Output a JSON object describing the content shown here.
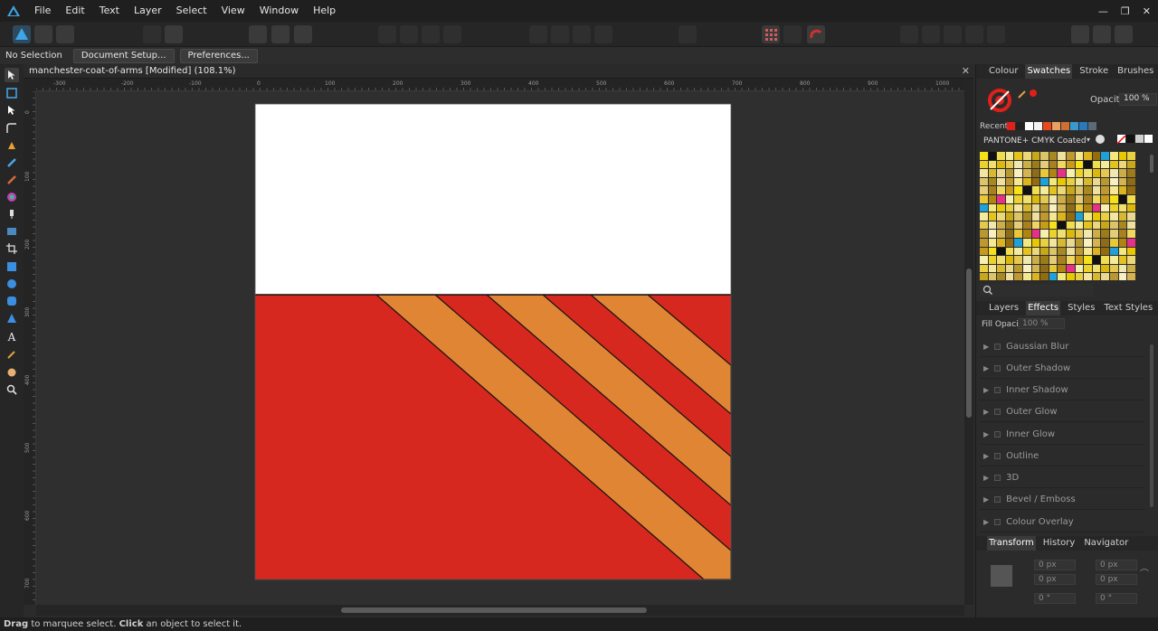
{
  "menu": [
    "File",
    "Edit",
    "Text",
    "Layer",
    "Select",
    "View",
    "Window",
    "Help"
  ],
  "window_controls": [
    "minimize",
    "restore",
    "close"
  ],
  "context": {
    "selection_label": "No Selection",
    "document_setup": "Document Setup...",
    "preferences": "Preferences..."
  },
  "document": {
    "tab_title": "manchester-coat-of-arms [Modified] (108.1%)",
    "close": "✕"
  },
  "ruler": {
    "h_ticks": [
      "-300",
      "-200",
      "-100",
      "0",
      "100",
      "200",
      "300",
      "400",
      "500",
      "600",
      "700",
      "800",
      "900",
      "1000"
    ],
    "v_ticks": [
      "0",
      "100",
      "200",
      "300",
      "400",
      "500",
      "600",
      "700"
    ]
  },
  "colors": {
    "white_band": "#ffffff",
    "red": "#d6281e",
    "orange": "#e08534",
    "outline": "#111111"
  },
  "status": {
    "drag": "Drag",
    "drag_text": " to marquee select. ",
    "click": "Click",
    "click_text": " an object to select it."
  },
  "swatches_panel": {
    "tabs": [
      "Colour",
      "Swatches",
      "Stroke",
      "Brushes"
    ],
    "active_tab": "Swatches",
    "opacity_label": "Opacity:",
    "opacity_value": "100 %",
    "recent_label": "Recent:",
    "palette_name": "PANTONE+ CMYK Coated",
    "recent_colors": [
      "#e0201a",
      "#222222",
      "#ffffff",
      "#f2f2f2",
      "#e8481c",
      "#e9a060",
      "#d07030",
      "#3a9ad0",
      "#2a7ab8",
      "#5a6a78"
    ],
    "grid_colors": [
      "#f7e21a",
      "#e6308a",
      "#1ea0d8",
      "#111111",
      "#f6f0b0",
      "#f3e880",
      "#f0de50",
      "#ecd22a",
      "#e8c800",
      "#f4ec9c",
      "#efe070",
      "#e9d040",
      "#e4c41c",
      "#dcb80c",
      "#f2e6a0",
      "#ecd878",
      "#e4c850",
      "#d8b830",
      "#c8a818",
      "#f0e8b0",
      "#e8d890",
      "#dcc468",
      "#ccae48",
      "#b89830",
      "#a88820",
      "#9c7c18",
      "#f8f0c0",
      "#f0e0a0",
      "#e4cc78",
      "#d4b450",
      "#c09830",
      "#a88020",
      "#8c6c18",
      "#f6e890",
      "#f0d860",
      "#e8c838",
      "#dcb420",
      "#c89c18",
      "#b08410",
      "#946c10"
    ]
  },
  "effects_panel": {
    "tabs": [
      "Layers",
      "Effects",
      "Styles",
      "Text Styles"
    ],
    "active_tab": "Effects",
    "fill_opacity_label": "Fill Opacity:",
    "fill_opacity_value": "100 %",
    "effects": [
      "Gaussian Blur",
      "Outer Shadow",
      "Inner Shadow",
      "Outer Glow",
      "Inner Glow",
      "Outline",
      "3D",
      "Bevel / Emboss",
      "Colour Overlay"
    ]
  },
  "transform_panel": {
    "tabs": [
      "Transform",
      "History",
      "Navigator"
    ],
    "active_tab": "Transform",
    "x": "0 px",
    "y": "0 px",
    "w": "0 px",
    "h": "0 px",
    "r": "0 °",
    "s": "0 °"
  }
}
